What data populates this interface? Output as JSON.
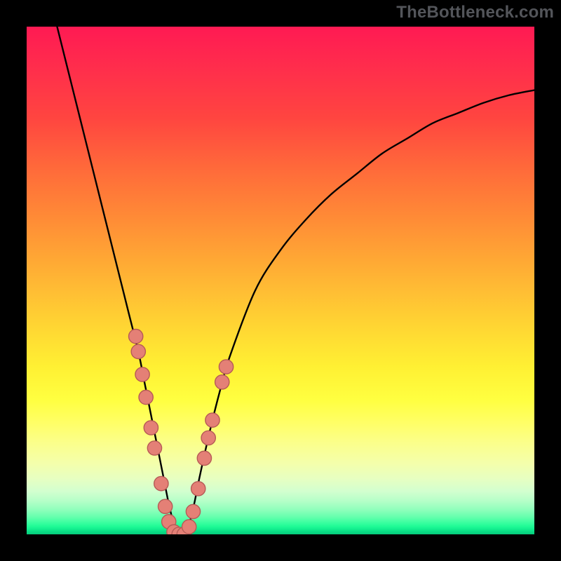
{
  "watermark": "TheBottleneck.com",
  "chart_data": {
    "type": "line",
    "title": "",
    "xlabel": "",
    "ylabel": "",
    "xlim": [
      0,
      100
    ],
    "ylim": [
      0,
      100
    ],
    "grid": false,
    "series": [
      {
        "name": "curve",
        "x": [
          6,
          8,
          10,
          12,
          14,
          16,
          18,
          20,
          22,
          23,
          24,
          25,
          26,
          27,
          28,
          29,
          30,
          31,
          32,
          33,
          34,
          36,
          38,
          40,
          45,
          50,
          55,
          60,
          65,
          70,
          75,
          80,
          85,
          90,
          95,
          100
        ],
        "y": [
          100,
          92,
          84,
          76,
          68,
          60,
          52,
          44,
          36,
          31,
          26,
          21,
          16,
          11,
          6,
          2,
          0,
          0,
          2,
          6,
          11,
          20,
          28,
          35,
          48,
          56,
          62,
          67,
          71,
          75,
          78,
          81,
          83,
          85,
          86.5,
          87.5
        ]
      }
    ],
    "markers": [
      {
        "x": 21.5,
        "y": 39
      },
      {
        "x": 22.0,
        "y": 36
      },
      {
        "x": 22.8,
        "y": 31.5
      },
      {
        "x": 23.5,
        "y": 27
      },
      {
        "x": 24.5,
        "y": 21
      },
      {
        "x": 25.2,
        "y": 17
      },
      {
        "x": 26.5,
        "y": 10
      },
      {
        "x": 27.3,
        "y": 5.5
      },
      {
        "x": 28.0,
        "y": 2.5
      },
      {
        "x": 29.0,
        "y": 0.5
      },
      {
        "x": 30.0,
        "y": 0
      },
      {
        "x": 31.0,
        "y": 0
      },
      {
        "x": 32.0,
        "y": 1.5
      },
      {
        "x": 32.8,
        "y": 4.5
      },
      {
        "x": 33.8,
        "y": 9
      },
      {
        "x": 35.0,
        "y": 15
      },
      {
        "x": 35.8,
        "y": 19
      },
      {
        "x": 36.6,
        "y": 22.5
      },
      {
        "x": 38.5,
        "y": 30
      },
      {
        "x": 39.3,
        "y": 33
      }
    ],
    "marker_style": {
      "fill": "#e48076",
      "stroke": "#b65a56",
      "radius_pct": 1.4
    }
  }
}
